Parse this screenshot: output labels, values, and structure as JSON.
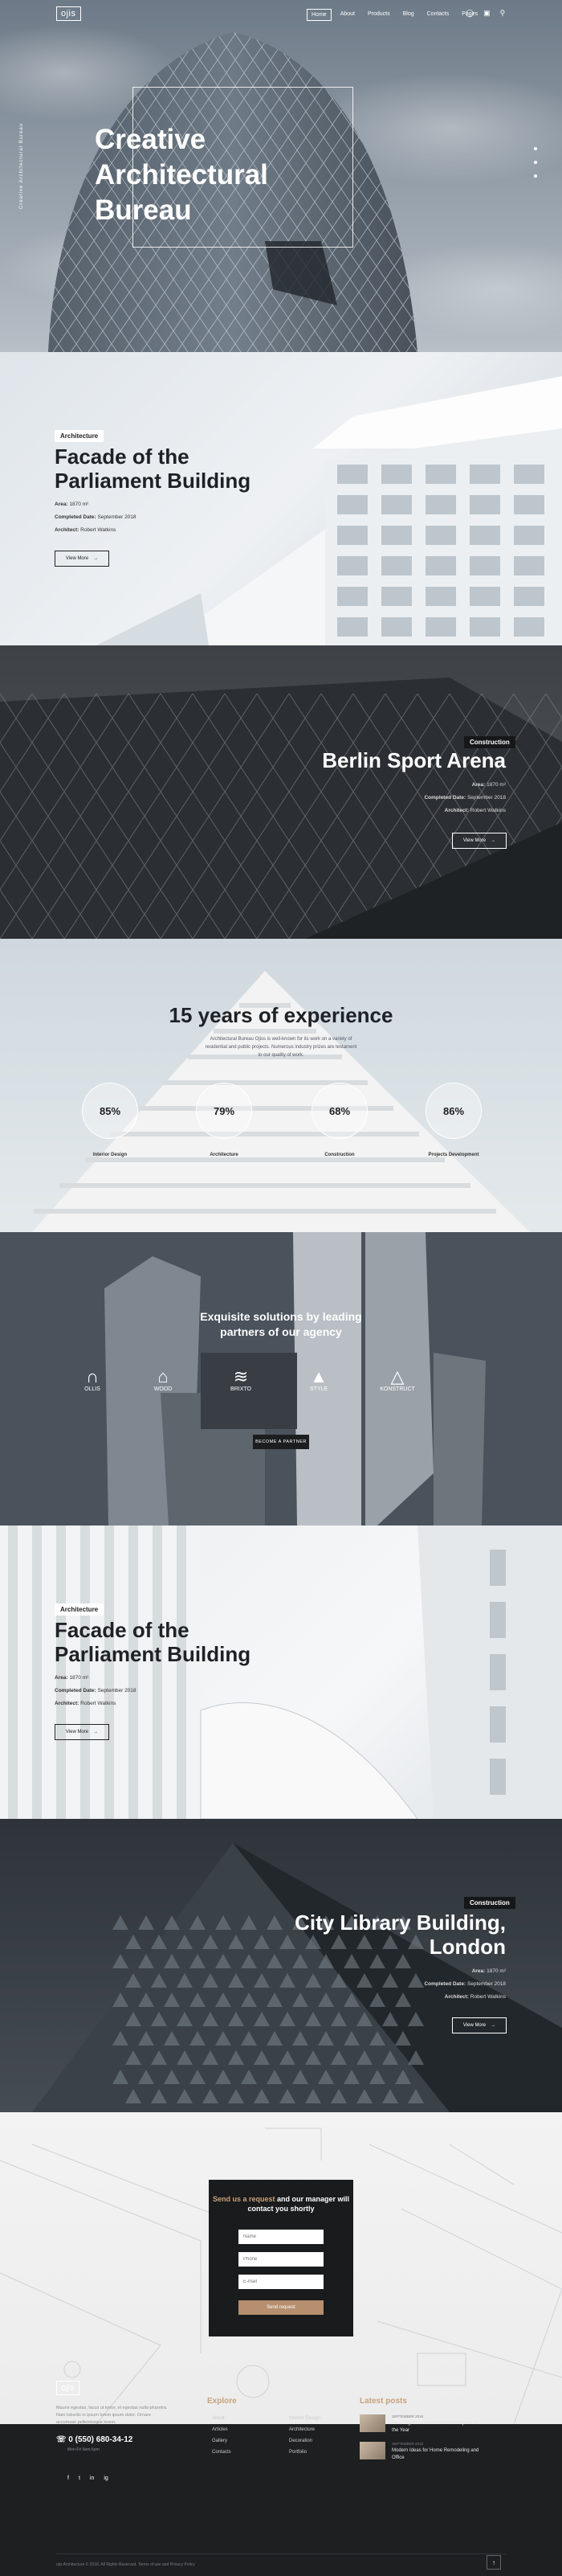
{
  "header": {
    "logo": "ojis",
    "nav": [
      {
        "label": "Home",
        "active": true
      },
      {
        "label": "About",
        "active": false
      },
      {
        "label": "Products",
        "active": false
      },
      {
        "label": "Blog",
        "active": false
      },
      {
        "label": "Contacts",
        "active": false
      },
      {
        "label": "Pages",
        "active": false
      }
    ],
    "icons": [
      "user-icon",
      "cart-icon",
      "search-icon"
    ]
  },
  "hero": {
    "title_line1": "Creative",
    "title_line2": "Architectural",
    "title_line3": "Bureau",
    "side_text": "Creative Architectural Bureau"
  },
  "projects": [
    {
      "badge": "Architecture",
      "title_line1": "Facade of the",
      "title_line2": "Parliament Building",
      "area_label": "Area:",
      "area_value": "1870 m²",
      "completed_label": "Completed Date:",
      "completed_value": "September 2018",
      "architect_label": "Architect:",
      "architect_value": "Robert Watkins",
      "button": "View More"
    },
    {
      "badge": "Construction",
      "title_line1": "Berlin Sport Arena",
      "area_label": "Area:",
      "area_value": "1870 m²",
      "completed_label": "Completed Date:",
      "completed_value": "September 2018",
      "architect_label": "Architect:",
      "architect_value": "Robert Watkins",
      "button": "View More"
    },
    {
      "badge": "Architecture",
      "title_line1": "Facade of the",
      "title_line2": "Parliament Building",
      "area_label": "Area:",
      "area_value": "1870 m²",
      "completed_label": "Completed Date:",
      "completed_value": "September 2018",
      "architect_label": "Architect:",
      "architect_value": "Robert Watkins",
      "button": "View More"
    },
    {
      "badge": "Construction",
      "title_line1": "City Library Building,",
      "title_line2": "London",
      "area_label": "Area:",
      "area_value": "1870 m²",
      "completed_label": "Completed Date:",
      "completed_value": "September 2018",
      "architect_label": "Architect:",
      "architect_value": "Robert Watkins",
      "button": "View More"
    }
  ],
  "experience": {
    "title": "15 years of experience",
    "text": "Architectural Bureau Ojiss is well-known for its work on a variety of residential and public projects. Numerous industry prizes are testament to our quality of work.",
    "stats": [
      {
        "value": "85%",
        "label": "Interior Design"
      },
      {
        "value": "79%",
        "label": "Architecture"
      },
      {
        "value": "68%",
        "label": "Construction"
      },
      {
        "value": "86%",
        "label": "Projects Development"
      }
    ]
  },
  "partners": {
    "title_line1": "Exquisite solutions by leading",
    "title_line2": "partners of our agency",
    "logos": [
      "OLLIS",
      "WOOD",
      "BRIXTO",
      "STYLE",
      "KONSTRUCT"
    ],
    "button": "BECOME A PARTNER"
  },
  "request": {
    "title_accent": "Send us a request",
    "title_rest": "and our manager will contact you shortly",
    "name_placeholder": "Name",
    "phone_placeholder": "Phone",
    "email_placeholder": "E-mail",
    "submit": "Send request"
  },
  "footer": {
    "logo": "ojis",
    "text": "Mauris egestas, lacus ut tortor, et egestas nulla pharetra. Nam lobortis in ipsum lorem ipsum dolor. Ornare accumsan pellentesque lorem.",
    "phone": "0 (550) 680-34-12",
    "hours": "Mon-Fri 9am-6pm",
    "social": [
      "f",
      "t",
      "in",
      "ig"
    ],
    "explore_heading": "Explore",
    "explore_col1": [
      "About",
      "Articles",
      "Gallery",
      "Contacts"
    ],
    "explore_col2": [
      "Interior Design",
      "Architecture",
      "Decoration",
      "Portfolio"
    ],
    "posts_heading": "Latest posts",
    "posts": [
      {
        "date": "SEPTEMBER 2018",
        "title": "Most Significant Architectural Projects of the Year"
      },
      {
        "date": "SEPTEMBER 2018",
        "title": "Modern Ideas for Home Remodeling and Office"
      }
    ],
    "copyright": "ojis Architecture © 2018. All Rights Reserved. Terms of use and Privacy Policy",
    "to_top": "↑"
  }
}
